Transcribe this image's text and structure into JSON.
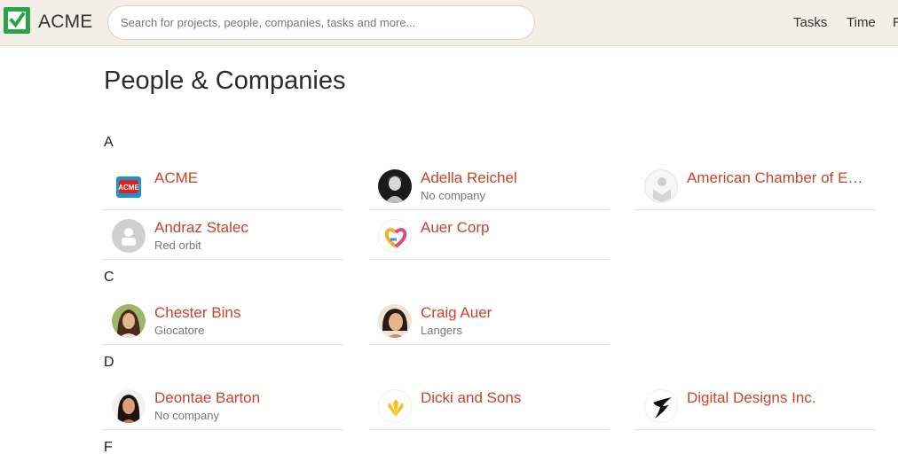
{
  "header": {
    "brand": "ACME",
    "search_placeholder": "Search for projects, people, companies, tasks and more...",
    "nav": [
      "Tasks",
      "Time",
      "R"
    ]
  },
  "page_title": "People & Companies",
  "sections": [
    {
      "letter": "A",
      "items": [
        {
          "name": "ACME",
          "sub": "",
          "avatar": "acme-logo-icon"
        },
        {
          "name": "Adella Reichel",
          "sub": "No company",
          "avatar": "user-photo"
        },
        {
          "name": "American Chamber of E…",
          "sub": "",
          "avatar": "company-placeholder-icon"
        },
        {
          "name": "Andraz Stalec",
          "sub": "Red orbit",
          "avatar": "person-placeholder-icon"
        },
        {
          "name": "Auer Corp",
          "sub": "",
          "avatar": "heart-logo-icon"
        }
      ]
    },
    {
      "letter": "C",
      "items": [
        {
          "name": "Chester Bins",
          "sub": "Giocatore",
          "avatar": "user-photo"
        },
        {
          "name": "Craig Auer",
          "sub": "Langers",
          "avatar": "user-photo"
        }
      ]
    },
    {
      "letter": "D",
      "items": [
        {
          "name": "Deontae Barton",
          "sub": "No company",
          "avatar": "user-photo"
        },
        {
          "name": "Dicki and Sons",
          "sub": "",
          "avatar": "sun-logo-icon"
        },
        {
          "name": "Digital Designs Inc.",
          "sub": "",
          "avatar": "bird-logo-icon"
        }
      ]
    },
    {
      "letter": "F",
      "items": []
    }
  ],
  "colors": {
    "accent": "#c8432a",
    "topbar": "#f3efe6",
    "brand_green": "#2aa44a"
  }
}
